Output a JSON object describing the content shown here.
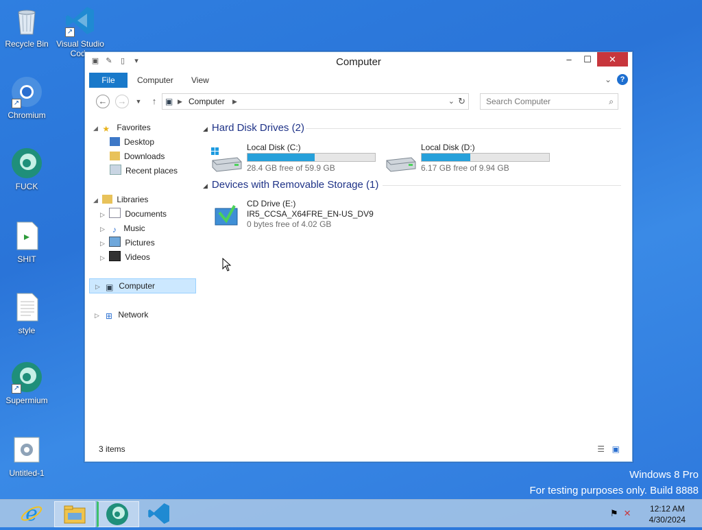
{
  "desktop": {
    "icons": [
      {
        "label": "Recycle Bin"
      },
      {
        "label": "Visual Studio Code"
      },
      {
        "label": "Chromium"
      },
      {
        "label": "FUCK"
      },
      {
        "label": "SHIT"
      },
      {
        "label": "style"
      },
      {
        "label": "Supermium"
      },
      {
        "label": "Untitled-1"
      }
    ],
    "watermark_line1": "Windows 8 Pro",
    "watermark_line2": "For testing purposes only. Build 8888"
  },
  "window": {
    "title": "Computer",
    "controls": {
      "minimize": "–",
      "maximize": "☐",
      "close": "✕"
    },
    "ribbon_tabs": [
      "File",
      "Computer",
      "View"
    ],
    "help": "?",
    "address": {
      "location": "Computer"
    },
    "search": {
      "placeholder": "Search Computer"
    },
    "nav": {
      "favorites": "Favorites",
      "desktop": "Desktop",
      "downloads": "Downloads",
      "recent": "Recent places",
      "libraries": "Libraries",
      "documents": "Documents",
      "music": "Music",
      "pictures": "Pictures",
      "videos": "Videos",
      "computer": "Computer",
      "network": "Network"
    },
    "groups": {
      "hdd": "Hard Disk Drives (2)",
      "removable": "Devices with Removable Storage (1)"
    },
    "drives": [
      {
        "name": "Local Disk (C:)",
        "free": "28.4 GB free of 59.9 GB",
        "used_fraction": 0.526
      },
      {
        "name": "Local Disk (D:)",
        "free": "6.17 GB free of 9.94 GB",
        "used_fraction": 0.38
      }
    ],
    "cd": {
      "name": "CD Drive (E:)",
      "label": "IR5_CCSA_X64FRE_EN-US_DV9",
      "free": "0 bytes free of 4.02 GB"
    },
    "status": "3 items"
  },
  "taskbar": {
    "time": "12:12 AM",
    "date": "4/30/2024"
  },
  "colors": {
    "accent": "#1979ca",
    "drive_bar": "#26a0da",
    "close": "#c7363c"
  }
}
